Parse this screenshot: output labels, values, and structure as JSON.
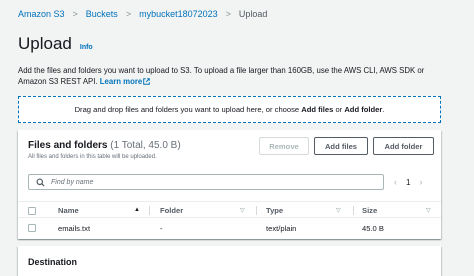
{
  "breadcrumb": {
    "items": [
      "Amazon S3",
      "Buckets",
      "mybucket18072023",
      "Upload"
    ],
    "separator": ">"
  },
  "page": {
    "title": "Upload",
    "info_label": "Info",
    "description_text": "Add the files and folders you want to upload to S3. To upload a file larger than 160GB, use the AWS CLI, AWS SDK or Amazon S3 REST API.",
    "learn_more_label": "Learn more"
  },
  "dropzone": {
    "prefix": "Drag and drop files and folders you want to upload here, or choose ",
    "add_files": "Add files",
    "middle": " or ",
    "add_folder": "Add folder",
    "suffix": "."
  },
  "files_panel": {
    "title": "Files and folders",
    "count": "(1 Total, 45.0 B)",
    "subtitle": "All files and folders in this table will be uploaded.",
    "remove_label": "Remove",
    "add_files_label": "Add files",
    "add_folder_label": "Add folder",
    "search_placeholder": "Find by name",
    "page_number": "1",
    "columns": [
      "Name",
      "Folder",
      "Type",
      "Size"
    ],
    "rows": [
      {
        "name": "emails.txt",
        "folder": "-",
        "type": "text/plain",
        "size": "45.0 B"
      }
    ]
  },
  "destination": {
    "title": "Destination"
  },
  "colors": {
    "link": "#0073bb",
    "background": "#f2f3f3",
    "text": "#16191f",
    "muted": "#687078"
  },
  "icons": [
    "external-link-icon",
    "search-icon",
    "chevron-left-icon",
    "chevron-right-icon",
    "sort-ascending-icon",
    "sort-icon"
  ]
}
